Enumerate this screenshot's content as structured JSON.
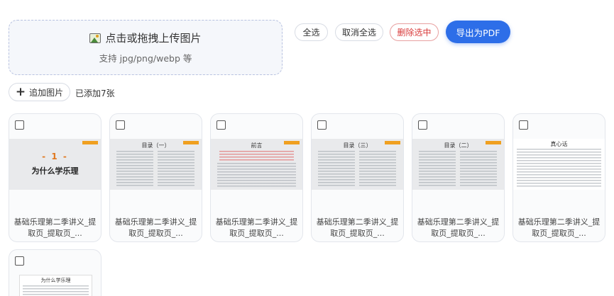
{
  "upload": {
    "title": "点击或拖拽上传图片",
    "subtitle": "支持 jpg/png/webp 等",
    "icon": "picture-icon"
  },
  "toolbar": {
    "select_all": "全选",
    "deselect_all": "取消全选",
    "delete_selected": "删除选中",
    "export_pdf": "导出为PDF"
  },
  "add": {
    "label": "追加图片",
    "icon": "plus-icon",
    "count_text": "已添加7张"
  },
  "colors": {
    "primary": "#2d6ee8",
    "danger": "#d83a3a",
    "accent": "#f0a020"
  },
  "images": [
    {
      "name": "基础乐理第二季讲义_提取页_提取页_...",
      "thumb_num": "- 1 -",
      "thumb_title": "为什么学乐理"
    },
    {
      "name": "基础乐理第二季讲义_提取页_提取页_...",
      "thumb_title": "目录（一）"
    },
    {
      "name": "基础乐理第二季讲义_提取页_提取页_...",
      "thumb_title": "前言"
    },
    {
      "name": "基础乐理第二季讲义_提取页_提取页_...",
      "thumb_title": "目录（三）"
    },
    {
      "name": "基础乐理第二季讲义_提取页_提取页_...",
      "thumb_title": "目录（二）"
    },
    {
      "name": "基础乐理第二季讲义_提取页_提取页_...",
      "thumb_title": "真心话"
    },
    {
      "name": "",
      "thumb_title": "为什么学乐理"
    }
  ]
}
